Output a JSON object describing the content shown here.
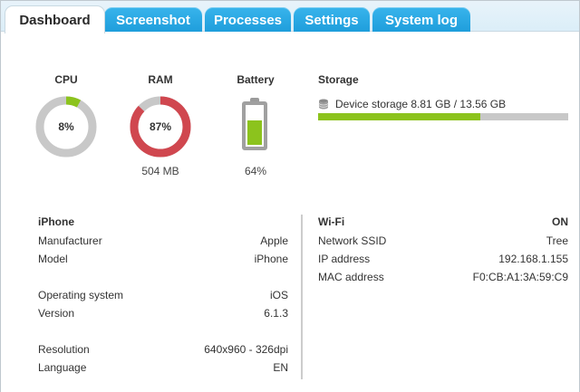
{
  "tabs": [
    {
      "label": "Dashboard",
      "active": true
    },
    {
      "label": "Screenshot",
      "active": false
    },
    {
      "label": "Processes",
      "active": false
    },
    {
      "label": "Settings",
      "active": false
    },
    {
      "label": "System log",
      "active": false
    }
  ],
  "colors": {
    "tab_blue": "#1e9ddb",
    "usage_green": "#8cc31d",
    "usage_red": "#d0474f",
    "track_gray": "#c8c8c8"
  },
  "cpu": {
    "title": "CPU",
    "percent_label": "8%",
    "percent": 8
  },
  "ram": {
    "title": "RAM",
    "percent_label": "87%",
    "percent": 87,
    "detail": "504 MB"
  },
  "battery": {
    "title": "Battery",
    "percent_label": "64%",
    "level": 64
  },
  "storage": {
    "title": "Storage",
    "label": "Device storage 8.81 GB / 13.56 GB",
    "used_gb": 8.81,
    "total_gb": 13.56,
    "icon": "database-icon"
  },
  "device": {
    "heading": "iPhone",
    "rows": [
      {
        "label": "Manufacturer",
        "value": "Apple"
      },
      {
        "label": "Model",
        "value": "iPhone"
      },
      {
        "label": "Operating system",
        "value": "iOS"
      },
      {
        "label": "Version",
        "value": "6.1.3"
      },
      {
        "label": "Resolution",
        "value": "640x960 - 326dpi"
      },
      {
        "label": "Language",
        "value": "EN"
      }
    ]
  },
  "wifi": {
    "heading": "Wi-Fi",
    "status": "ON",
    "rows": [
      {
        "label": "Network SSID",
        "value": "Tree"
      },
      {
        "label": "IP address",
        "value": "192.168.1.155"
      },
      {
        "label": "MAC address",
        "value": "F0:CB:A1:3A:59:C9"
      }
    ]
  }
}
